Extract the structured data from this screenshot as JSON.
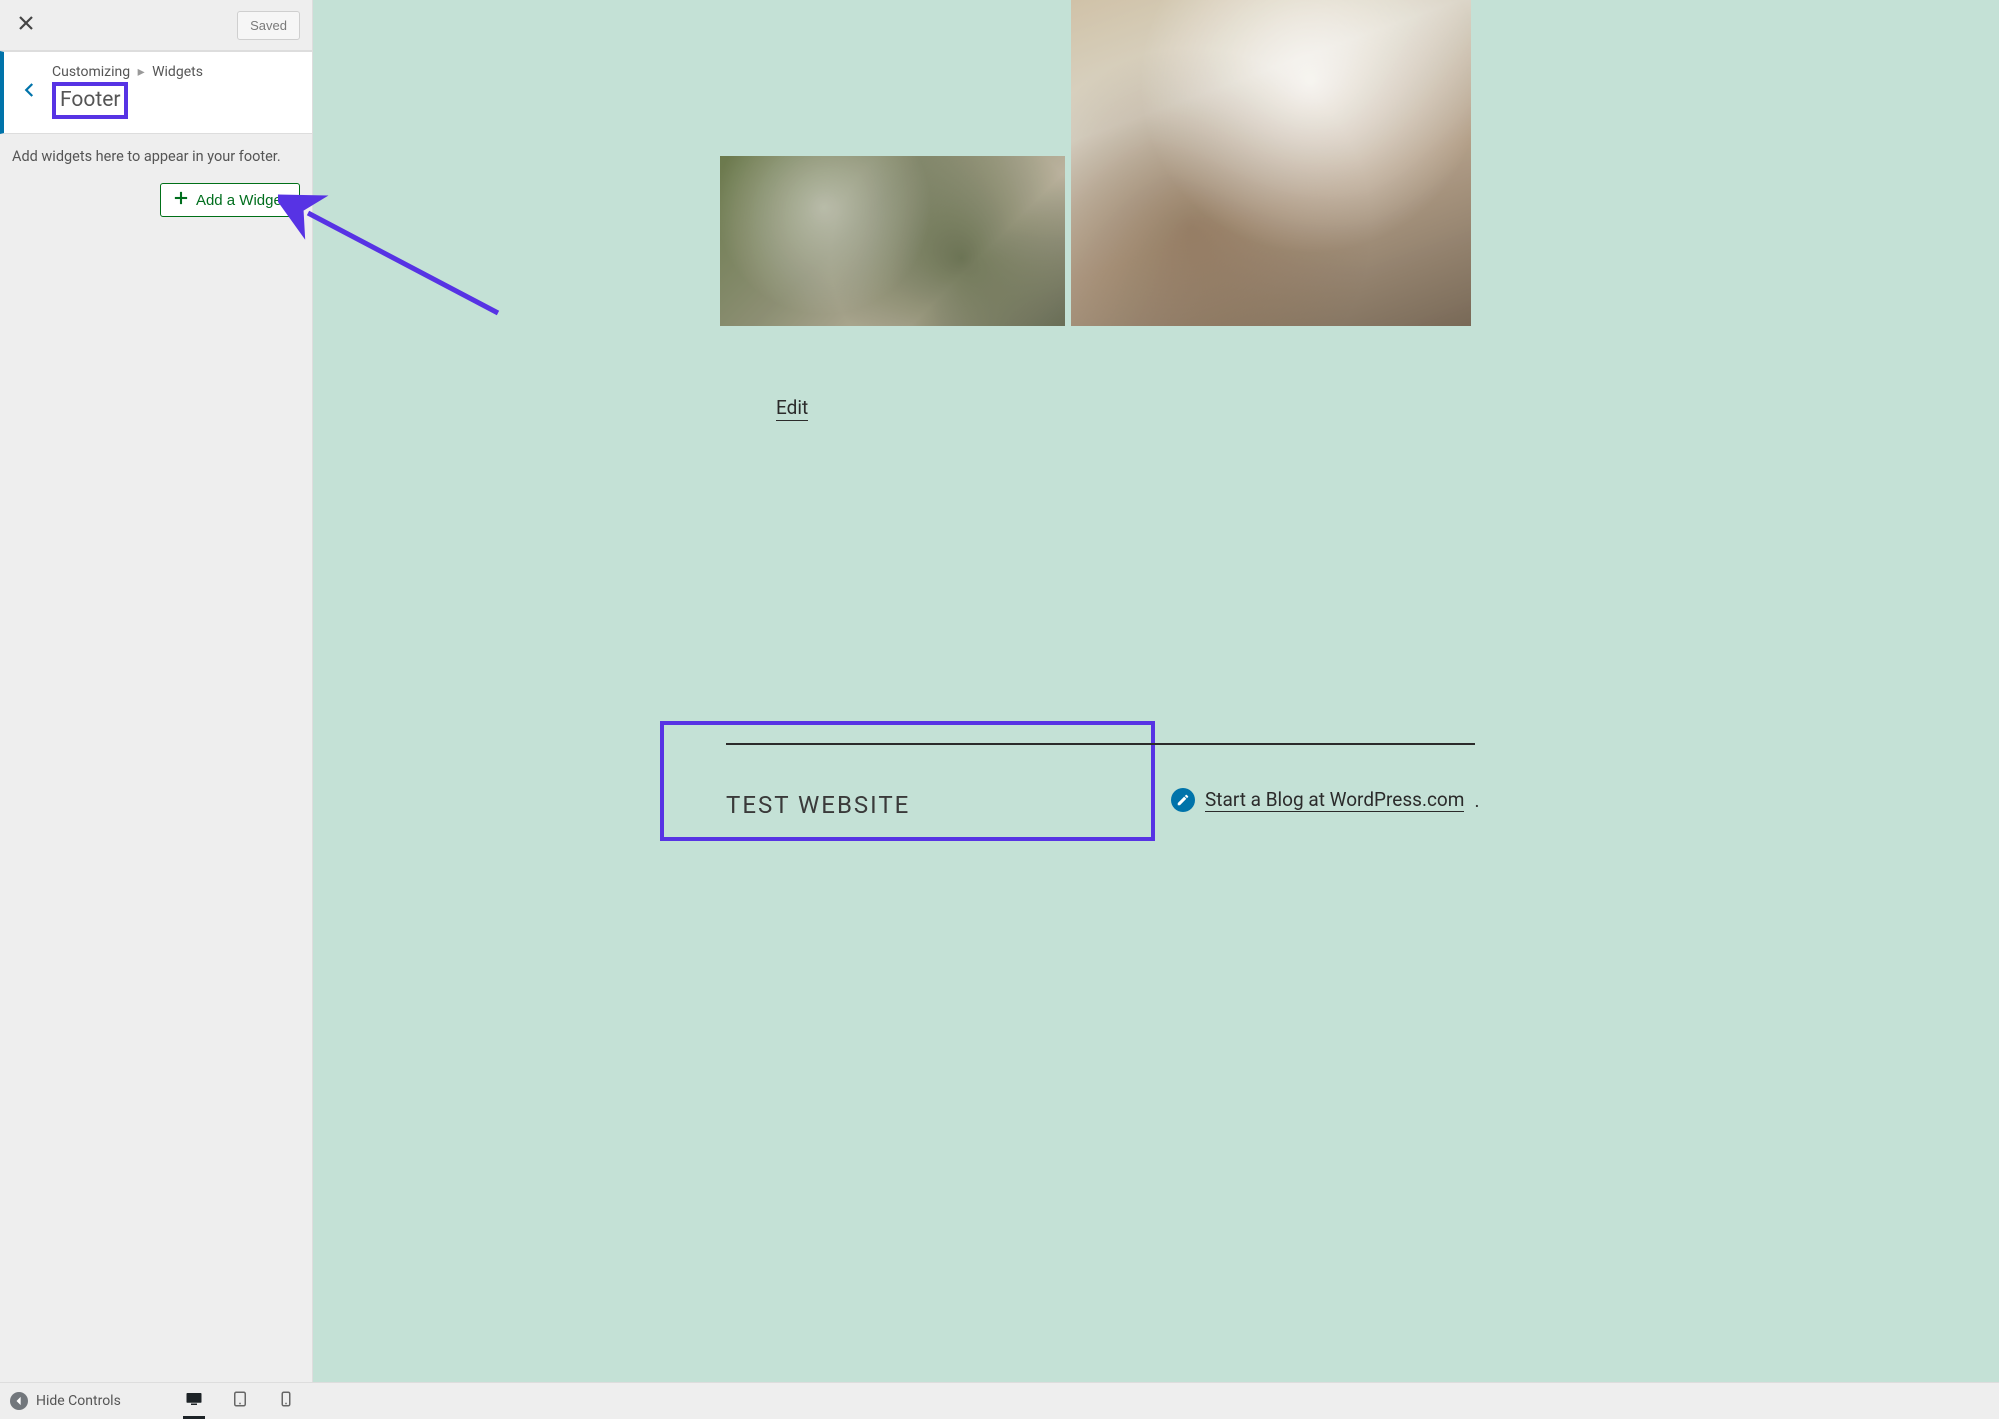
{
  "sidebar": {
    "saved_label": "Saved",
    "breadcrumb_parent": "Customizing",
    "breadcrumb_child": "Widgets",
    "section_title": "Footer",
    "description": "Add widgets here to appear in your footer.",
    "add_widget_label": "Add a Widget"
  },
  "bottombar": {
    "hide_label": "Hide Controls"
  },
  "preview": {
    "edit_label": "Edit",
    "site_title": "TEST WEBSITE",
    "wp_link_text": "Start a Blog at WordPress.com"
  },
  "colors": {
    "accent_purple": "#5733e4",
    "wp_blue": "#0073aa",
    "preview_bg": "#c4e1d6"
  }
}
